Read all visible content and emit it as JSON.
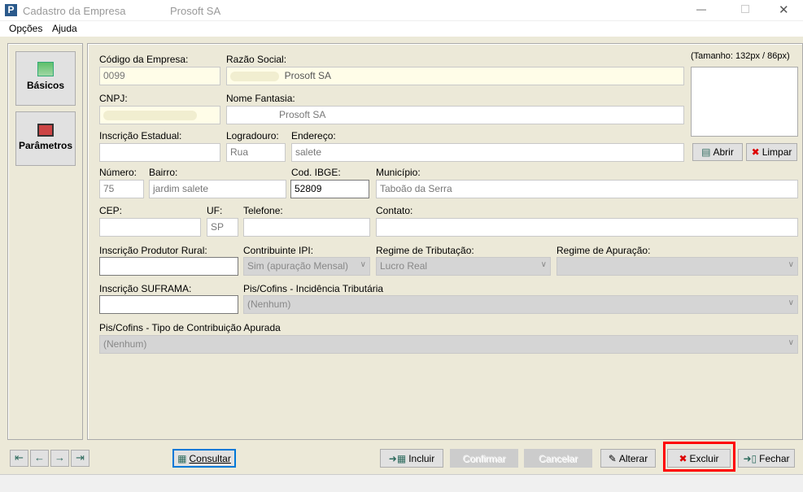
{
  "window": {
    "title": "Cadastro da Empresa",
    "company": "Prosoft SA",
    "app_icon_letter": "P"
  },
  "menu": [
    "Opções",
    "Ajuda"
  ],
  "sidebar": {
    "items": [
      {
        "label": "Básicos"
      },
      {
        "label": "Parâmetros"
      }
    ]
  },
  "form": {
    "codigo": {
      "label": "Código da Empresa:",
      "value": "0099"
    },
    "razao": {
      "label": "Razão Social:",
      "value": "Prosoft SA"
    },
    "cnpj": {
      "label": "CNPJ:",
      "value": ""
    },
    "fantasia": {
      "label": "Nome Fantasia:",
      "value": "Prosoft SA"
    },
    "ie": {
      "label": "Inscrição Estadual:",
      "value": ""
    },
    "logradouro": {
      "label": "Logradouro:",
      "value": "Rua"
    },
    "endereco": {
      "label": "Endereço:",
      "value": "salete"
    },
    "numero": {
      "label": "Número:",
      "value": "75"
    },
    "bairro": {
      "label": "Bairro:",
      "value": "jardim salete"
    },
    "ibge": {
      "label": "Cod. IBGE:",
      "value": "52809"
    },
    "municipio": {
      "label": "Município:",
      "value": "Taboão da Serra"
    },
    "cep": {
      "label": "CEP:",
      "value": ""
    },
    "uf": {
      "label": "UF:",
      "value": "SP"
    },
    "telefone": {
      "label": "Telefone:",
      "value": ""
    },
    "contato": {
      "label": "Contato:",
      "value": ""
    },
    "produtor": {
      "label": "Inscrição Produtor Rural:",
      "value": ""
    },
    "ipi": {
      "label": "Contribuinte IPI:",
      "value": "Sim (apuração Mensal)"
    },
    "regime_trib": {
      "label": "Regime de Tributação:",
      "value": "Lucro Real"
    },
    "regime_apur": {
      "label": "Regime de Apuração:",
      "value": ""
    },
    "suframa": {
      "label": "Inscrição SUFRAMA:",
      "value": ""
    },
    "pis_incid": {
      "label": "Pis/Cofins - Incidência Tributária",
      "value": "(Nenhum)"
    },
    "pis_tipo": {
      "label": "Pis/Cofins - Tipo de Contribuição Apurada",
      "value": "(Nenhum)"
    }
  },
  "logo": {
    "size_hint": "(Tamanho: 132px / 86px)",
    "open": "Abrir",
    "clear": "Limpar"
  },
  "toolbar": {
    "consultar": "Consultar",
    "incluir": "Incluir",
    "confirmar": "Confirmar",
    "cancelar": "Cancelar",
    "alterar": "Alterar",
    "excluir": "Excluir",
    "fechar": "Fechar"
  },
  "colors": {
    "highlight": "#ff0000",
    "readonly": "#fffde8",
    "background": "#ece9d8"
  }
}
